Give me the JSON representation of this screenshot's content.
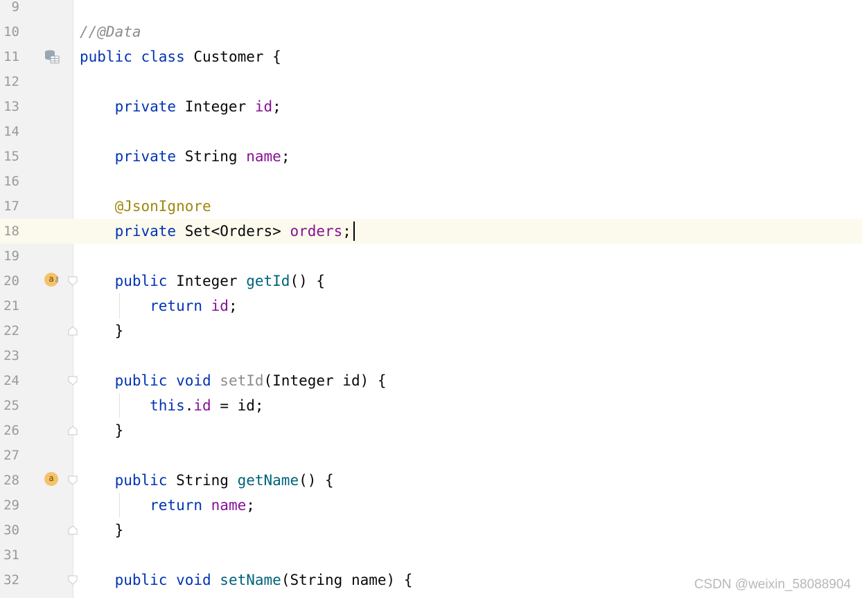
{
  "editor": {
    "language": "java",
    "current_line": "18",
    "colors": {
      "keyword": "#0033b3",
      "field": "#871094",
      "method": "#00627a",
      "annotation": "#9e880d",
      "comment": "#8c8c8c",
      "gutter_bg": "#f2f2f2",
      "current_line_bg": "#fcfaed"
    },
    "lines": [
      {
        "num": "9",
        "tokens": []
      },
      {
        "num": "10",
        "tokens": [
          {
            "t": "//@Data",
            "k": "comment"
          }
        ]
      },
      {
        "num": "11",
        "tokens": [
          {
            "t": "public class ",
            "k": "keyword"
          },
          {
            "t": "Customer {",
            "k": "plain"
          }
        ],
        "gutter_icon": "database-table-icon"
      },
      {
        "num": "12",
        "tokens": []
      },
      {
        "num": "13",
        "tokens": [
          {
            "t": "    private ",
            "k": "keyword"
          },
          {
            "t": "Integer ",
            "k": "plain"
          },
          {
            "t": "id",
            "k": "field"
          },
          {
            "t": ";",
            "k": "plain"
          }
        ]
      },
      {
        "num": "14",
        "tokens": []
      },
      {
        "num": "15",
        "tokens": [
          {
            "t": "    private ",
            "k": "keyword"
          },
          {
            "t": "String ",
            "k": "plain"
          },
          {
            "t": "name",
            "k": "field"
          },
          {
            "t": ";",
            "k": "plain"
          }
        ]
      },
      {
        "num": "16",
        "tokens": []
      },
      {
        "num": "17",
        "tokens": [
          {
            "t": "    @JsonIgnore",
            "k": "annotation"
          }
        ]
      },
      {
        "num": "18",
        "tokens": [
          {
            "t": "    private ",
            "k": "keyword"
          },
          {
            "t": "Set<Orders> ",
            "k": "plain"
          },
          {
            "t": "orders",
            "k": "field"
          },
          {
            "t": ";",
            "k": "plain"
          }
        ],
        "caret": true
      },
      {
        "num": "19",
        "tokens": []
      },
      {
        "num": "20",
        "tokens": [
          {
            "t": "    public ",
            "k": "keyword"
          },
          {
            "t": "Integer ",
            "k": "plain"
          },
          {
            "t": "getId",
            "k": "method"
          },
          {
            "t": "() {",
            "k": "plain"
          }
        ],
        "badge": "a",
        "badge_key": true,
        "fold": "open"
      },
      {
        "num": "21",
        "tokens": [
          {
            "t": "        return ",
            "k": "keyword"
          },
          {
            "t": "id",
            "k": "field"
          },
          {
            "t": ";",
            "k": "plain"
          }
        ]
      },
      {
        "num": "22",
        "tokens": [
          {
            "t": "    }",
            "k": "plain"
          }
        ],
        "fold": "close"
      },
      {
        "num": "23",
        "tokens": []
      },
      {
        "num": "24",
        "tokens": [
          {
            "t": "    public void ",
            "k": "keyword"
          },
          {
            "t": "setId",
            "k": "unused"
          },
          {
            "t": "(Integer id) {",
            "k": "plain"
          }
        ],
        "fold": "open"
      },
      {
        "num": "25",
        "tokens": [
          {
            "t": "        this",
            "k": "keyword"
          },
          {
            "t": ".",
            "k": "plain"
          },
          {
            "t": "id",
            "k": "field"
          },
          {
            "t": " = id;",
            "k": "plain"
          }
        ]
      },
      {
        "num": "26",
        "tokens": [
          {
            "t": "    }",
            "k": "plain"
          }
        ],
        "fold": "close"
      },
      {
        "num": "27",
        "tokens": []
      },
      {
        "num": "28",
        "tokens": [
          {
            "t": "    public ",
            "k": "keyword"
          },
          {
            "t": "String ",
            "k": "plain"
          },
          {
            "t": "getName",
            "k": "method"
          },
          {
            "t": "() {",
            "k": "plain"
          }
        ],
        "badge": "a",
        "fold": "open"
      },
      {
        "num": "29",
        "tokens": [
          {
            "t": "        return ",
            "k": "keyword"
          },
          {
            "t": "name",
            "k": "field"
          },
          {
            "t": ";",
            "k": "plain"
          }
        ]
      },
      {
        "num": "30",
        "tokens": [
          {
            "t": "    }",
            "k": "plain"
          }
        ],
        "fold": "close"
      },
      {
        "num": "31",
        "tokens": []
      },
      {
        "num": "32",
        "tokens": [
          {
            "t": "    public void ",
            "k": "keyword"
          },
          {
            "t": "setName",
            "k": "method"
          },
          {
            "t": "(String name) {",
            "k": "plain"
          }
        ],
        "fold": "open"
      }
    ]
  },
  "watermark": "CSDN @weixin_58088904"
}
